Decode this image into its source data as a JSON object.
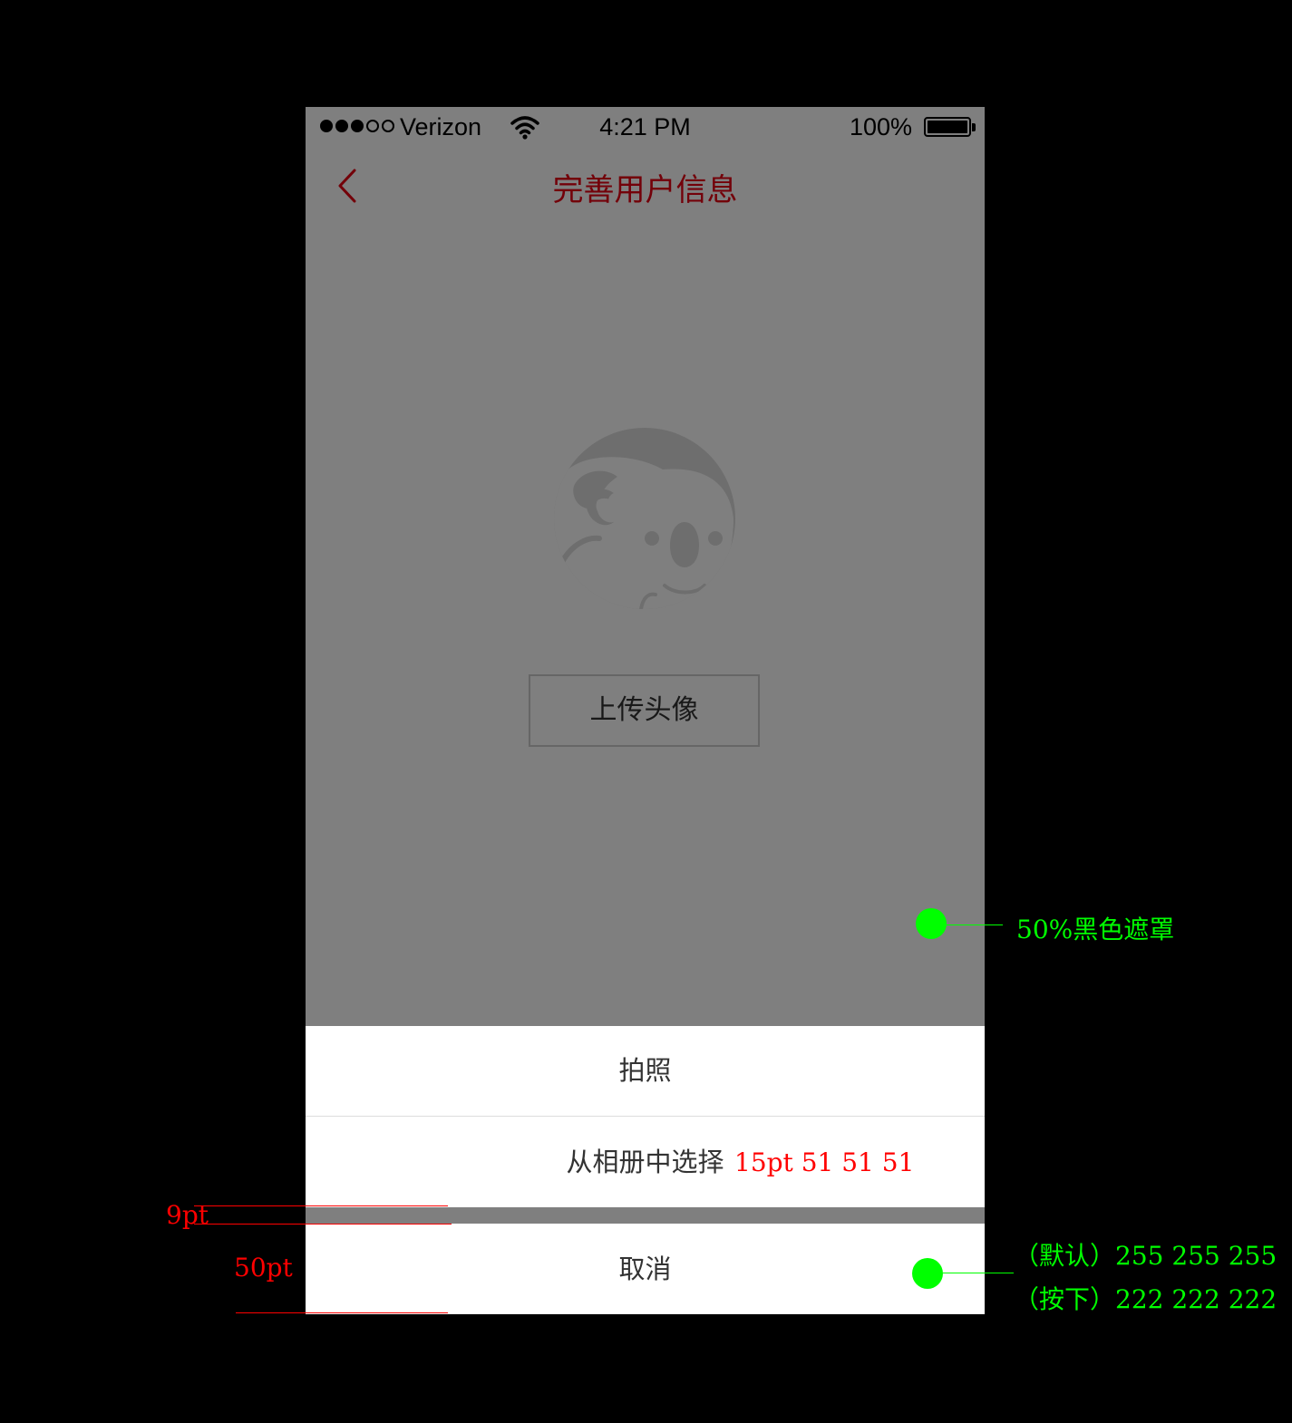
{
  "status_bar": {
    "carrier": "Verizon",
    "time": "4:21 PM",
    "battery": "100%",
    "signal_bars_filled": 3,
    "signal_bars_total": 5
  },
  "nav": {
    "title": "完善用户信息",
    "back_icon": "chevron-left-icon",
    "title_color": "#e60012"
  },
  "profile": {
    "avatar_icon": "koala-avatar-icon",
    "upload_label": "上传头像"
  },
  "overlay": {
    "opacity": 0.5
  },
  "action_sheet": {
    "items": [
      {
        "label": "拍照"
      },
      {
        "label": "从相册中选择"
      }
    ],
    "cancel_label": "取消"
  },
  "annotations": {
    "font_spec": "15pt  51  51  51",
    "gap_spec": "9pt",
    "height_spec": "50pt",
    "mask_note": "50%黑色遮罩",
    "default_color": "（默认）255 255 255",
    "pressed_color": "（按下）222 222 222",
    "red": "#ff0000",
    "green": "#00ff00"
  }
}
